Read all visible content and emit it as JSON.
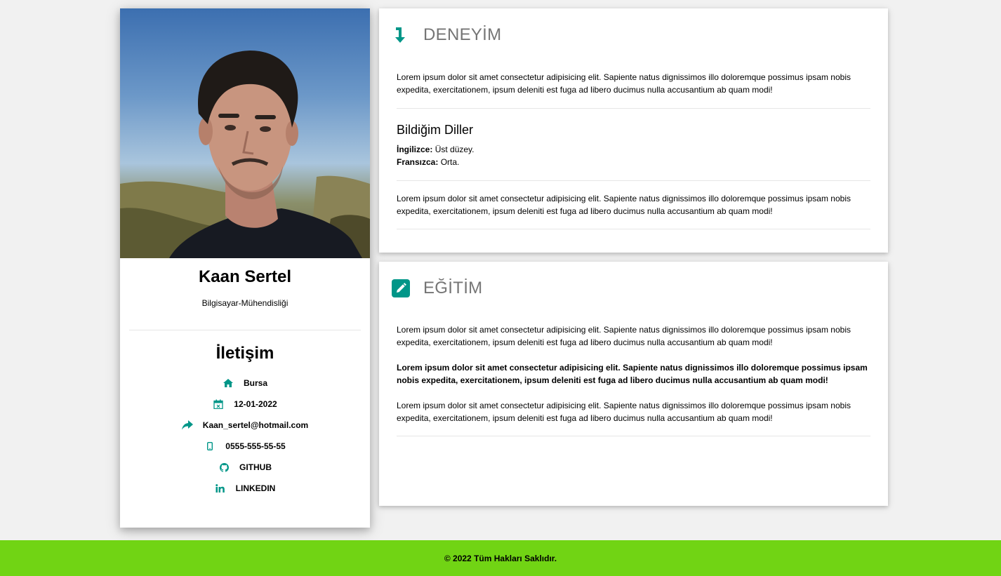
{
  "profile": {
    "name": "Kaan Sertel",
    "title": "Bilgisayar-Mühendisliği",
    "contact_heading": "İletişim",
    "contacts": [
      {
        "icon": "home-icon",
        "text": "Bursa"
      },
      {
        "icon": "calendar-icon",
        "text": "12-01-2022"
      },
      {
        "icon": "share-arrow-icon",
        "text": "Kaan_sertel@hotmail.com"
      },
      {
        "icon": "mobile-phone-icon",
        "text": "0555-555-55-55"
      },
      {
        "icon": "github-icon",
        "text": "GITHUB"
      },
      {
        "icon": "linkedin-icon",
        "text": "LINKEDIN"
      }
    ]
  },
  "experience": {
    "heading": "DENEYİM",
    "icon": "arrow-down-icon",
    "para1": "Lorem ipsum dolor sit amet consectetur adipisicing elit. Sapiente natus dignissimos illo doloremque possimus ipsam nobis expedita, exercitationem, ipsum deleniti est fuga ad libero ducimus nulla accusantium ab quam modi!",
    "languages_heading": "Bildiğim Diller",
    "languages": [
      {
        "label": "İngilizce:",
        "level": "Üst düzey."
      },
      {
        "label": "Fransızca:",
        "level": "Orta."
      }
    ],
    "para2": "Lorem ipsum dolor sit amet consectetur adipisicing elit. Sapiente natus dignissimos illo doloremque possimus ipsam nobis expedita, exercitationem, ipsum deleniti est fuga ad libero ducimus nulla accusantium ab quam modi!"
  },
  "education": {
    "heading": "EĞİTİM",
    "icon": "pencil-square-icon",
    "para1": "Lorem ipsum dolor sit amet consectetur adipisicing elit. Sapiente natus dignissimos illo doloremque possimus ipsam nobis expedita, exercitationem, ipsum deleniti est fuga ad libero ducimus nulla accusantium ab quam modi!",
    "para2": "Lorem ipsum dolor sit amet consectetur adipisicing elit. Sapiente natus dignissimos illo doloremque possimus ipsam nobis expedita, exercitationem, ipsum deleniti est fuga ad libero ducimus nulla accusantium ab quam modi!",
    "para3": "Lorem ipsum dolor sit amet consectetur adipisicing elit. Sapiente natus dignissimos illo doloremque possimus ipsam nobis expedita, exercitationem, ipsum deleniti est fuga ad libero ducimus nulla accusantium ab quam modi!"
  },
  "footer": {
    "text": "© 2022 Tüm Hakları Saklıdır."
  },
  "colors": {
    "accent": "#009688",
    "footer_bg": "#71d414",
    "heading_gray": "#757575"
  }
}
